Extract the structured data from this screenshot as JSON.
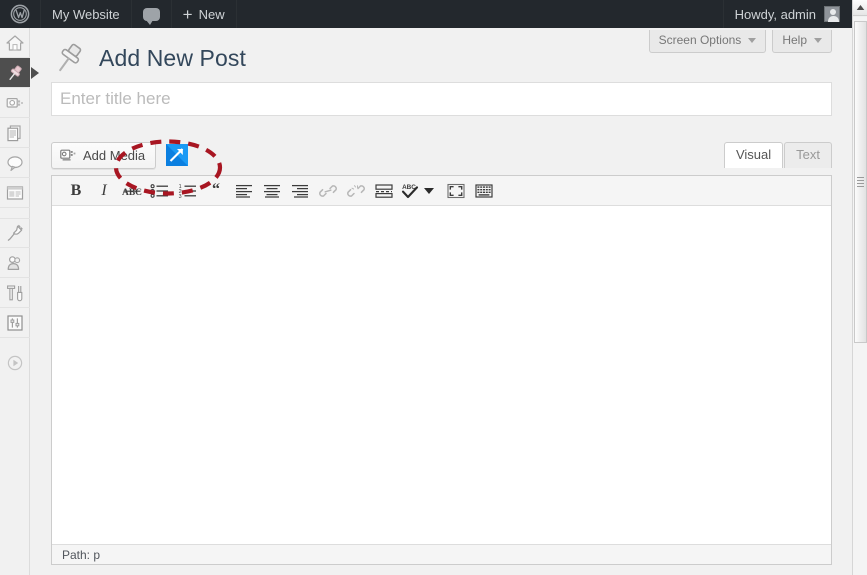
{
  "adminbar": {
    "logo_icon": "wordpress-logo-icon",
    "site_name": "My Website",
    "comments_icon": "comment-bubble-icon",
    "comments_label": "",
    "new_plus": "+",
    "new_label": "New",
    "howdy": "Howdy, admin",
    "avatar_icon": "user-avatar-icon"
  },
  "adminmenu": {
    "items": [
      {
        "name": "dashboard",
        "icon": "home-icon",
        "active": false
      },
      {
        "name": "posts",
        "icon": "pin-icon",
        "active": true
      },
      {
        "name": "media",
        "icon": "camera-icon",
        "active": false
      },
      {
        "name": "pages",
        "icon": "pages-icon",
        "active": false
      },
      {
        "name": "comments",
        "icon": "comment-bubble-icon",
        "active": false
      },
      {
        "name": "appearance",
        "icon": "appearance-icon",
        "active": false
      },
      {
        "name": "plugins",
        "icon": "plug-icon",
        "active": false
      },
      {
        "name": "users",
        "icon": "users-icon",
        "active": false
      },
      {
        "name": "tools",
        "icon": "tools-icon",
        "active": false
      },
      {
        "name": "settings",
        "icon": "settings-icon",
        "active": false
      },
      {
        "name": "collapse-menu",
        "icon": "collapse-arrow-icon",
        "active": false
      }
    ]
  },
  "screen_meta": {
    "screen_options_label": "Screen Options",
    "help_label": "Help"
  },
  "page": {
    "title": "Add New Post",
    "title_icon": "pin-icon"
  },
  "title_field": {
    "value": "",
    "placeholder": "Enter title here"
  },
  "media_buttons": {
    "add_media_label": "Add Media",
    "add_media_icon": "insert-media-icon",
    "plugin_button_icon": "blue-arrow-icon"
  },
  "editor_tabs": {
    "visual_label": "Visual",
    "text_label": "Text",
    "active": "Visual"
  },
  "toolbar": {
    "buttons": [
      {
        "name": "bold-button",
        "glyph": "B",
        "disabled": false
      },
      {
        "name": "italic-button",
        "glyph": "I",
        "disabled": false
      },
      {
        "name": "strikethrough-button",
        "glyph": "ABC",
        "disabled": false
      },
      {
        "name": "bulleted-list-button",
        "glyph": "",
        "disabled": false
      },
      {
        "name": "numbered-list-button",
        "glyph": "",
        "disabled": false
      },
      {
        "name": "blockquote-button",
        "glyph": "““",
        "disabled": false
      },
      {
        "name": "align-left-button",
        "glyph": "",
        "disabled": false
      },
      {
        "name": "align-center-button",
        "glyph": "",
        "disabled": false
      },
      {
        "name": "align-right-button",
        "glyph": "",
        "disabled": false
      },
      {
        "name": "insert-link-button",
        "glyph": "",
        "disabled": true
      },
      {
        "name": "remove-link-button",
        "glyph": "",
        "disabled": true
      },
      {
        "name": "insert-more-tag-button",
        "glyph": "",
        "disabled": false
      },
      {
        "name": "spellcheck-button",
        "glyph": "ABC",
        "disabled": false
      },
      {
        "name": "fullscreen-button",
        "glyph": "",
        "disabled": false
      },
      {
        "name": "kitchen-sink-button",
        "glyph": "",
        "disabled": false
      }
    ]
  },
  "statusbar": {
    "path_label": "Path:",
    "path_value": "p"
  },
  "annotation": {
    "shape": "ellipse",
    "style": "dashed",
    "color": "#a81622"
  },
  "scrollbar": {
    "up_arrow_icon": "scroll-up-arrow-icon",
    "grip_icon": "scrollbar-grip-icon"
  },
  "colors": {
    "adminbar_bg": "#23282d",
    "body_bg": "#f1f1f1",
    "accent_blue": "#0b7fe0",
    "title_text": "#33475b",
    "annotation_red": "#a81622"
  }
}
